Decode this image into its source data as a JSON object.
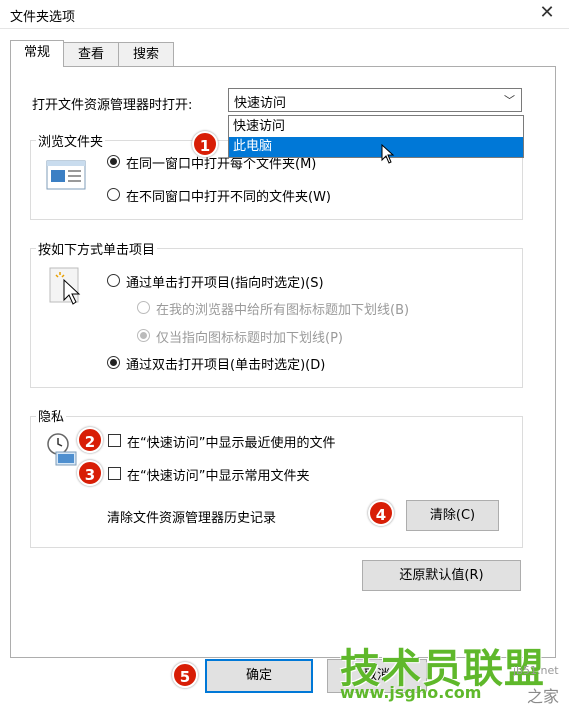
{
  "window": {
    "title": "文件夹选项",
    "close_glyph": "✕"
  },
  "tabs": [
    {
      "label": "常规",
      "active": true
    },
    {
      "label": "查看",
      "active": false
    },
    {
      "label": "搜索",
      "active": false
    }
  ],
  "open_explorer": {
    "label": "打开文件资源管理器时打开:",
    "value": "快速访问",
    "options": [
      "快速访问",
      "此电脑"
    ],
    "highlighted_option": "此电脑"
  },
  "browse_folders": {
    "title": "浏览文件夹",
    "option_same_window": "在同一窗口中打开每个文件夹(M)",
    "option_new_window": "在不同窗口中打开不同的文件夹(W)",
    "selected": "same_window"
  },
  "click_items": {
    "title": "按如下方式单击项目",
    "option_single": "通过单击打开项目(指向时选定)(S)",
    "sub_underline_all": "在我的浏览器中给所有图标标题加下划线(B)",
    "sub_underline_point": "仅当指向图标标题时加下划线(P)",
    "option_double": "通过双击打开项目(单击时选定)(D)",
    "selected": "double"
  },
  "privacy": {
    "title": "隐私",
    "show_recent_files": "在“快速访问”中显示最近使用的文件",
    "show_frequent_folders": "在“快速访问”中显示常用文件夹",
    "clear_history_label": "清除文件资源管理器历史记录",
    "clear_button": "清除(C)"
  },
  "restore_defaults_button": "还原默认值(R)",
  "footer": {
    "ok_button": "确定",
    "cancel_button": "取消"
  },
  "annotations": [
    "1",
    "2",
    "3",
    "4",
    "5"
  ],
  "watermark": {
    "main": "技术员联盟",
    "url": "www.jsgho.com",
    "side": "jb51.net",
    "side2": "之家"
  },
  "colors": {
    "selection": "#0078d7",
    "badge": "#d81e06",
    "watermark": "#5fb82b"
  },
  "icons": [
    "close-icon",
    "chevron-down-icon",
    "mouse-cursor-icon",
    "window-preview-icon",
    "click-pointer-icon",
    "clock-icon"
  ]
}
